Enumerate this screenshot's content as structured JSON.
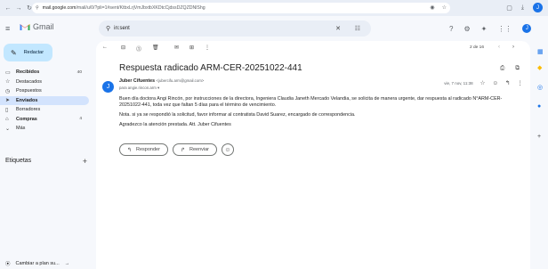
{
  "browser": {
    "url_prefix": "mail.google.com",
    "url_rest": "/mail/u/0/?pli=1#sent/KtbxLrjVmJbxtbXKDtcCjdssDZQZDNlShg"
  },
  "header": {
    "app_name": "Gmail",
    "search_value": "in:sent",
    "avatar_letter": "J"
  },
  "compose": {
    "label": "Redactar"
  },
  "sidebar": {
    "items": [
      {
        "label": "Recibidos",
        "count": "40",
        "icon": "inbox-icon",
        "glyph": "▭"
      },
      {
        "label": "Destacados",
        "count": "",
        "icon": "star-icon",
        "glyph": "☆"
      },
      {
        "label": "Pospuestos",
        "count": "",
        "icon": "clock-icon",
        "glyph": "◷"
      },
      {
        "label": "Enviados",
        "count": "",
        "icon": "send-icon",
        "glyph": "➤"
      },
      {
        "label": "Borradores",
        "count": "",
        "icon": "draft-icon",
        "glyph": "▯"
      },
      {
        "label": "Compras",
        "count": "4",
        "icon": "tag-icon",
        "glyph": "⌂"
      },
      {
        "label": "Más",
        "count": "",
        "icon": "chevron-down-icon",
        "glyph": "⌄"
      }
    ],
    "labels_heading": "Etiquetas",
    "upgrade": "Cambiar a plan su..."
  },
  "toolbar": {
    "pager": "2 de 16"
  },
  "email": {
    "subject": "Respuesta radicado ARM-CER-20251022-441",
    "sender_name": "Juber Cifuentes",
    "sender_email": "<jubercifu.arm@gmail.com>",
    "to": "para angie.rincon.arm",
    "date": "vie, 7 nov, 11:38",
    "avatar_letter": "J",
    "paragraphs": [
      "Buen día doctora Angi Rincón, por instrucciones de la directora, Ingeniera Claudia Janeth Mercado Velandia, se solicita de manera urgente, dar respuesta al radicado N°ARM-CER-20251022-441, toda vez que faltan 5 días para el término de vencimiento.",
      "Nota. si ya se respondió la solicitud, favor informar al contratista David Suarez, encargado de correspondencia.",
      "Agradezco la atención prestada. Att. Juber Cifuentes"
    ],
    "reply_label": "Responder",
    "forward_label": "Reenviar"
  }
}
